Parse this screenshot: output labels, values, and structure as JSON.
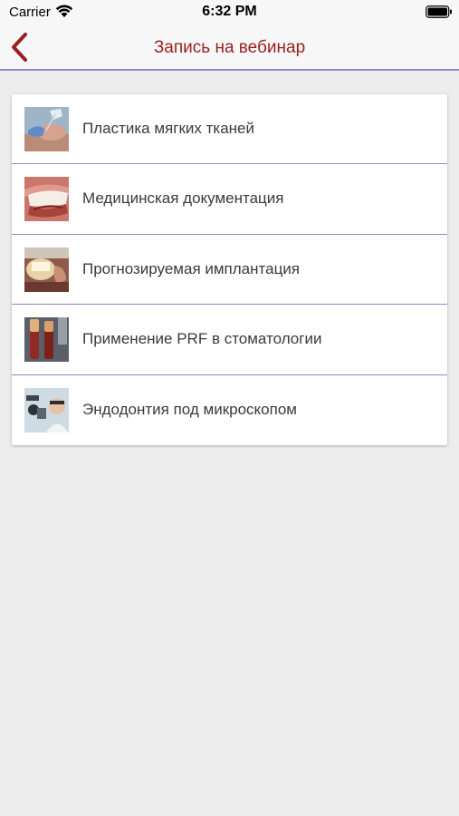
{
  "status_bar": {
    "carrier": "Carrier",
    "time": "6:32 PM"
  },
  "nav": {
    "title": "Запись на вебинар",
    "back_icon": "chevron-left-icon",
    "accent_color": "#9a1f1f",
    "divider_color": "#8e8bc8"
  },
  "webinars": [
    {
      "label": "Пластика мягких тканей"
    },
    {
      "label": "Медицинская документация"
    },
    {
      "label": "Прогнозируемая имплантация"
    },
    {
      "label": "Применение PRF в стоматологии"
    },
    {
      "label": "Эндодонтия под микроскопом"
    }
  ]
}
